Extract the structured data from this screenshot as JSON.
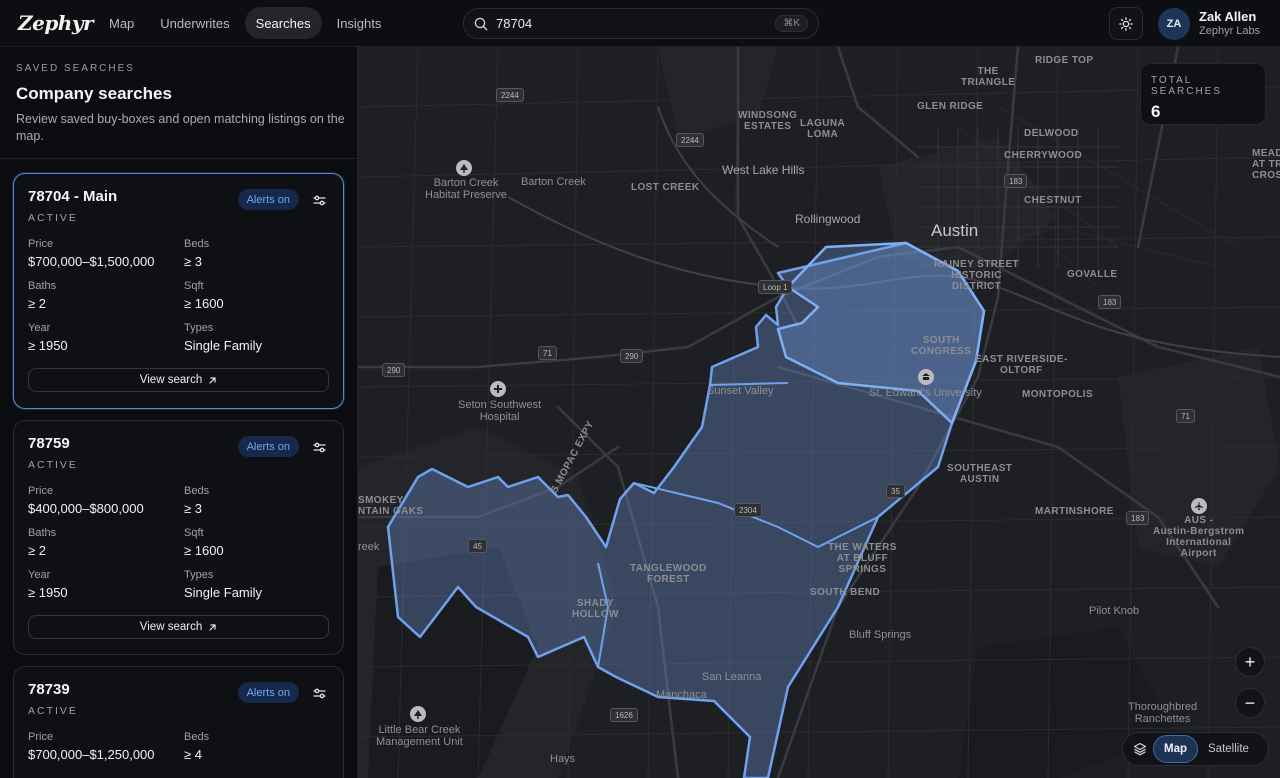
{
  "app": {
    "logo": "Zephyr"
  },
  "nav": [
    {
      "label": "Map",
      "active": false
    },
    {
      "label": "Underwrites",
      "active": false
    },
    {
      "label": "Searches",
      "active": true
    },
    {
      "label": "Insights",
      "active": false
    }
  ],
  "search": {
    "value": "78704",
    "shortcut": "⌘K"
  },
  "user": {
    "initials": "ZA",
    "name": "Zak Allen",
    "org": "Zephyr Labs"
  },
  "sidebar": {
    "eyebrow": "SAVED SEARCHES",
    "title": "Company searches",
    "description": "Review saved buy-boxes and open matching listings on the map.",
    "cards": [
      {
        "title": "78704 - Main",
        "status": "ACTIVE",
        "badge": "Alerts on",
        "price_label": "Price",
        "price": "$700,000–$1,500,000",
        "beds_label": "Beds",
        "beds": "≥ 3",
        "baths_label": "Baths",
        "baths": "≥ 2",
        "sqft_label": "Sqft",
        "sqft": "≥ 1600",
        "year_label": "Year",
        "year": "≥ 1950",
        "types_label": "Types",
        "types": "Single Family",
        "button": "View search"
      },
      {
        "title": "78759",
        "status": "ACTIVE",
        "badge": "Alerts on",
        "price_label": "Price",
        "price": "$400,000–$800,000",
        "beds_label": "Beds",
        "beds": "≥ 3",
        "baths_label": "Baths",
        "baths": "≥ 2",
        "sqft_label": "Sqft",
        "sqft": "≥ 1600",
        "year_label": "Year",
        "year": "≥ 1950",
        "types_label": "Types",
        "types": "Single Family",
        "button": "View search"
      },
      {
        "title": "78739",
        "status": "ACTIVE",
        "badge": "Alerts on",
        "price_label": "Price",
        "price": "$700,000–$1,250,000",
        "beds_label": "Beds",
        "beds": "≥ 4"
      }
    ]
  },
  "map": {
    "total_label": "TOTAL SEARCHES",
    "total_value": "6",
    "zoom_in": "+",
    "zoom_out": "−",
    "layers": [
      "Map",
      "Satellite"
    ],
    "active_layer": "Map",
    "labels": {
      "austin": "Austin",
      "west_lake_hills": "West Lake Hills",
      "rollingwood": "Rollingwood",
      "barton_creek": "Barton Creek",
      "barton_creek_preserve": "Barton Creek\nHabitat Preserve",
      "lost_creek": "LOST CREEK",
      "windsong": "WINDSONG\nESTATES",
      "laguna_loma": "LAGUNA\nLOMA",
      "the_triangle": "THE\nTRIANGLE",
      "glen_ridge": "GLEN RIDGE",
      "ridge_top": "RIDGE TOP",
      "delwood": "DELWOOD",
      "cherrywood": "CHERRYWOOD",
      "chestnut": "CHESTNUT",
      "meadow": "MEADOW\nAT TRINIT\nCROSSIN",
      "rainey": "RAINEY STREET\nHISTORIC\nDISTRICT",
      "govalle": "GOVALLE",
      "south_congress": "SOUTH\nCONGRESS",
      "east_riverside": "EAST RIVERSIDE-\nOLTORF",
      "st_edwards": "St. Edward's University",
      "montopolis": "MONTOPOLIS",
      "sunset_valley": "Sunset Valley",
      "seton": "Seton Southwest\nHospital",
      "southeast_austin": "SOUTHEAST\nAUSTIN",
      "martinshore": "MARTINSHORE",
      "aus": "AUS -\nAustin-Bergstrom\nInternational\nAirport",
      "smokey": "SMOKEY\nNTAIN OAKS",
      "reek": "reek",
      "shady_hollow": "SHADY\nHOLLOW",
      "tanglewood": "TANGLEWOOD\nFOREST",
      "waters": "THE WATERS\nAT BLUFF\nSPRINGS",
      "south_bend": "SOUTH BEND",
      "pilot_knob": "Pilot Knob",
      "bluff_springs": "Bluff Springs",
      "san_leanna": "San Leanna",
      "manchaca": "Manchaca",
      "little_bear": "Little Bear Creek\nManagement Unit",
      "hays": "Hays",
      "thoroughbred": "Thoroughbred\nRanchettes",
      "mopac": "S MOPAC EXPY"
    },
    "shields": [
      "2244",
      "2244",
      "Loop 1",
      "71",
      "290",
      "290",
      "183",
      "183",
      "35",
      "2304",
      "45",
      "1626",
      "71",
      "183"
    ]
  }
}
